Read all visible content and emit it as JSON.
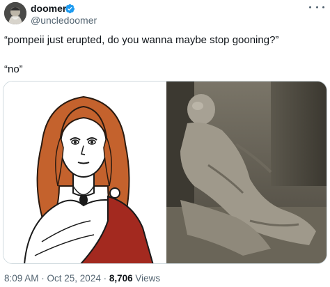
{
  "author": {
    "display_name": "doomer",
    "handle": "@uncledoomer",
    "verified": true,
    "avatar_icon": "avatar-wizard"
  },
  "tweet": {
    "line1": "“pompeii just erupted, do you wanna maybe stop gooning?”",
    "line2": "“no”"
  },
  "media": {
    "left_image": "illustration of woman with red wavy hair and toga",
    "right_image": "photo of pompeii plaster cast body"
  },
  "footer": {
    "time": "8:09 AM",
    "sep1": " · ",
    "date": "Oct 25, 2024",
    "sep2": " · ",
    "views_count": "8,706",
    "views_label": " Views"
  },
  "colors": {
    "verified_blue": "#1d9bf0",
    "hair": "#c4622d",
    "toga_red": "#a3291f"
  }
}
